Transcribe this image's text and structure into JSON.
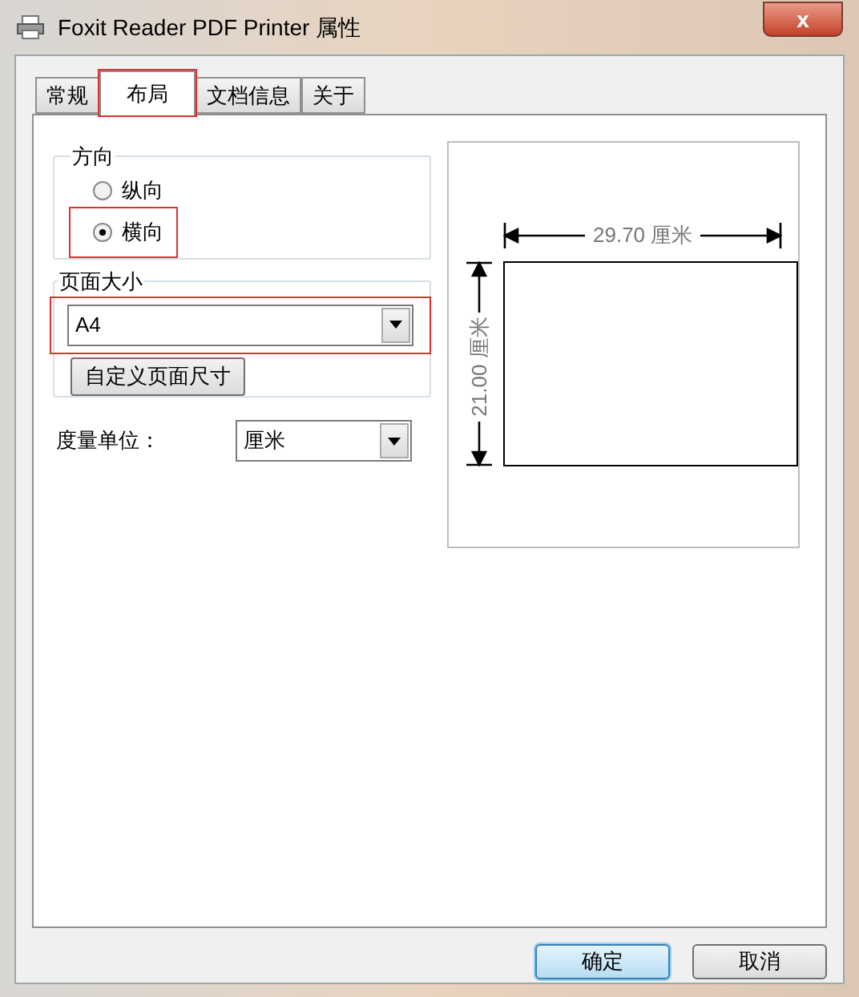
{
  "window": {
    "title": "Foxit Reader PDF Printer 属性",
    "close": "x"
  },
  "tabs": [
    {
      "label": "常规",
      "selected": false,
      "highlighted": false
    },
    {
      "label": "布局",
      "selected": true,
      "highlighted": true
    },
    {
      "label": "文档信息",
      "selected": false,
      "highlighted": false
    },
    {
      "label": "关于",
      "selected": false,
      "highlighted": false
    }
  ],
  "orientation": {
    "title": "方向",
    "options": [
      {
        "label": "纵向",
        "selected": false,
        "highlighted": false
      },
      {
        "label": "横向",
        "selected": true,
        "highlighted": true
      }
    ]
  },
  "page_size": {
    "title": "页面大小",
    "value": "A4",
    "highlighted": true,
    "custom_button": "自定义页面尺寸"
  },
  "units": {
    "label": "度量单位：",
    "value": "厘米"
  },
  "preview": {
    "width_label": "29.70 厘米",
    "height_label": "21.00 厘米"
  },
  "buttons": [
    {
      "label": "确定",
      "default": true
    },
    {
      "label": "取消",
      "default": false
    }
  ]
}
